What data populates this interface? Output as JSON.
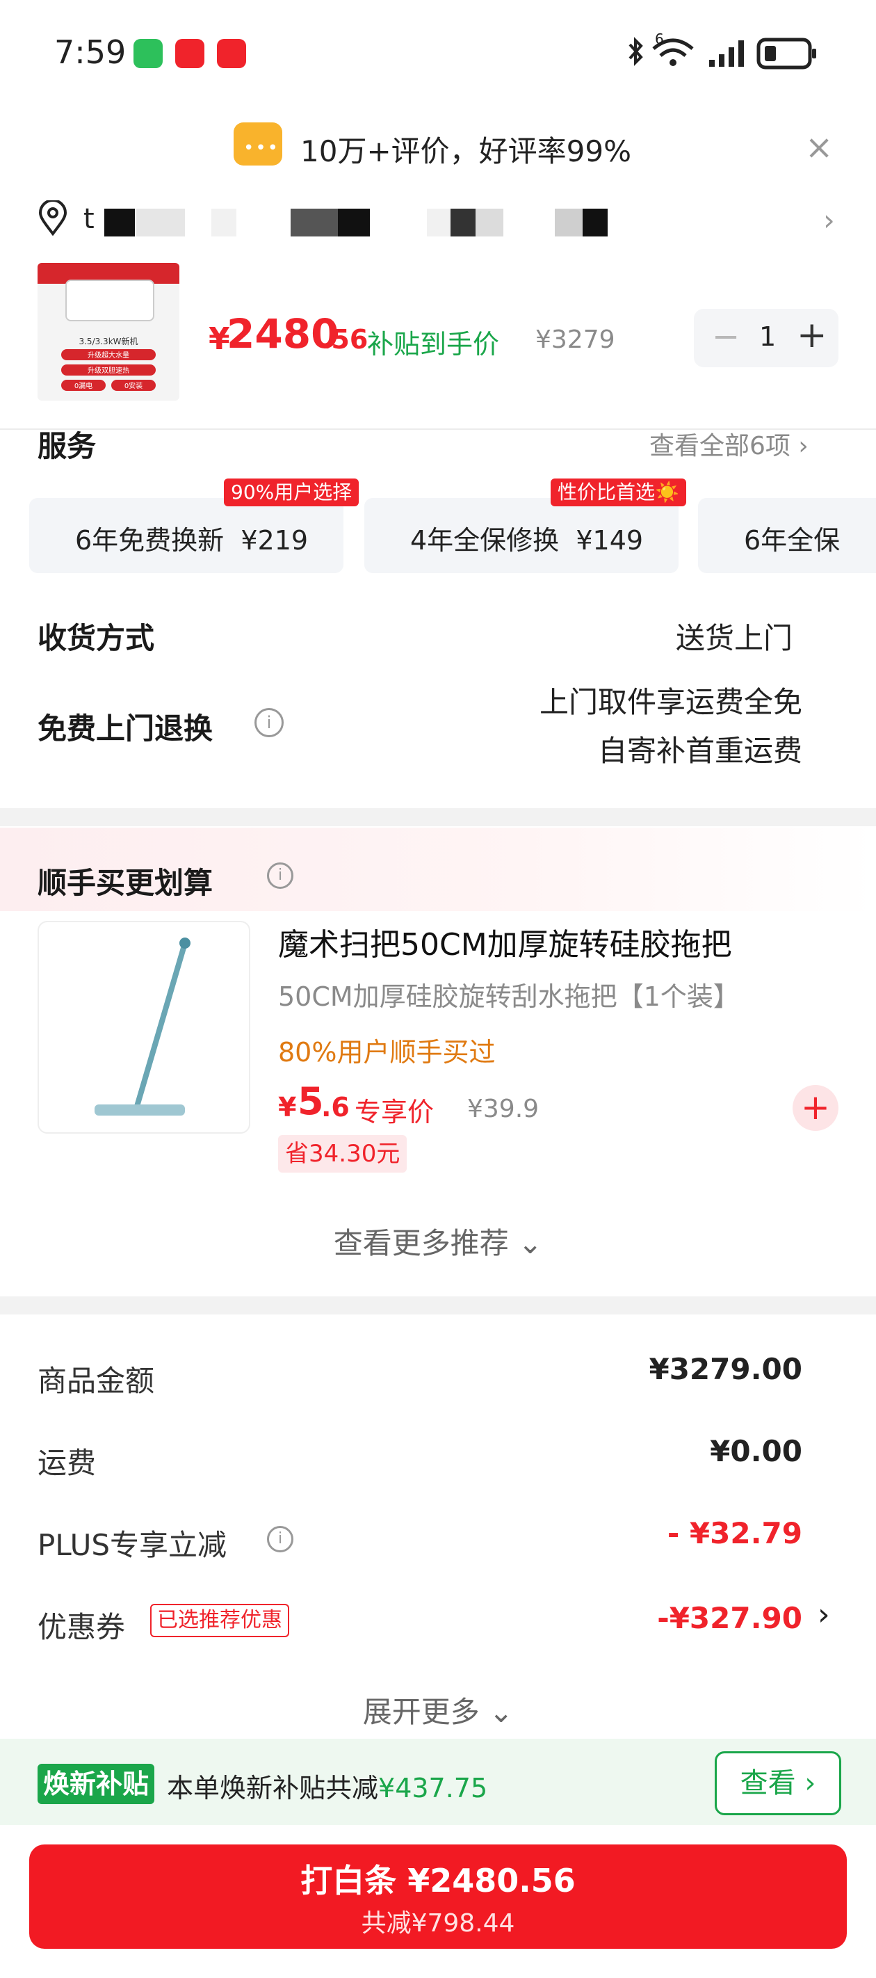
{
  "status_bar": {
    "time": "7:59",
    "network": "6",
    "battery": "low"
  },
  "banner": {
    "text": "10万+评价，好评率99%",
    "close": "×"
  },
  "address": {
    "prefix": "t",
    "chevron": "›"
  },
  "product": {
    "yen": "¥",
    "price_int": "2480",
    "price_dec": ".56",
    "subsidy_label": "补贴到手价",
    "orig_price": "¥3279",
    "qty": {
      "minus": "−",
      "value": "1",
      "plus": "+"
    },
    "img": {
      "caption": "3.5/3.3kW新机",
      "tags": [
        "升级超大水量",
        "升级双胆速热",
        "0漏电",
        "0安装"
      ]
    }
  },
  "services": {
    "title": "服务",
    "view_all": "查看全部6项 ›",
    "cards": [
      {
        "text": "6年免费换新  ¥219",
        "badge": "90%用户选择"
      },
      {
        "text": "4年全保修换  ¥149",
        "badge": "性价比首选☀️"
      },
      {
        "text": "6年全保",
        "badge": ""
      }
    ]
  },
  "delivery": {
    "label": "收货方式",
    "value": "送货上门",
    "return_label": "免费上门退换",
    "return_line1": "上门取件享运费全免",
    "return_line2": "自寄补首重运费"
  },
  "addon": {
    "title": "顺手买更划算",
    "item": {
      "title": "魔术扫把50CM加厚旋转硅胶拖把",
      "subtitle": "50CM加厚硅胶旋转刮水拖把【1个装】",
      "bought": "80%用户顺手买过",
      "yen": "¥",
      "price_int": "5",
      "price_dec": ".6",
      "exclusive": "专享价",
      "orig": "¥39.9",
      "save": "省34.30元",
      "add": "+"
    },
    "more": "查看更多推荐 ⌄"
  },
  "totals": {
    "goods_label": "商品金额",
    "goods_val": "¥3279.00",
    "ship_label": "运费",
    "ship_val": "¥0.00",
    "plus_label": "PLUS专享立减",
    "plus_val": "- ¥32.79",
    "coupon_label": "优惠券",
    "coupon_tag": "已选推荐优惠",
    "coupon_val": "-¥327.90",
    "coupon_chev": "›",
    "expand": "展开更多 ⌄"
  },
  "subsidy": {
    "tag": "焕新补贴",
    "text": "本单焕新补贴共减",
    "amount": "¥437.75",
    "button": "查看 ›"
  },
  "pay": {
    "main": "打白条 ¥2480.56",
    "sub": "共减¥798.44"
  },
  "colors": {
    "accent": "#f0232b",
    "green": "#1aa64a"
  }
}
